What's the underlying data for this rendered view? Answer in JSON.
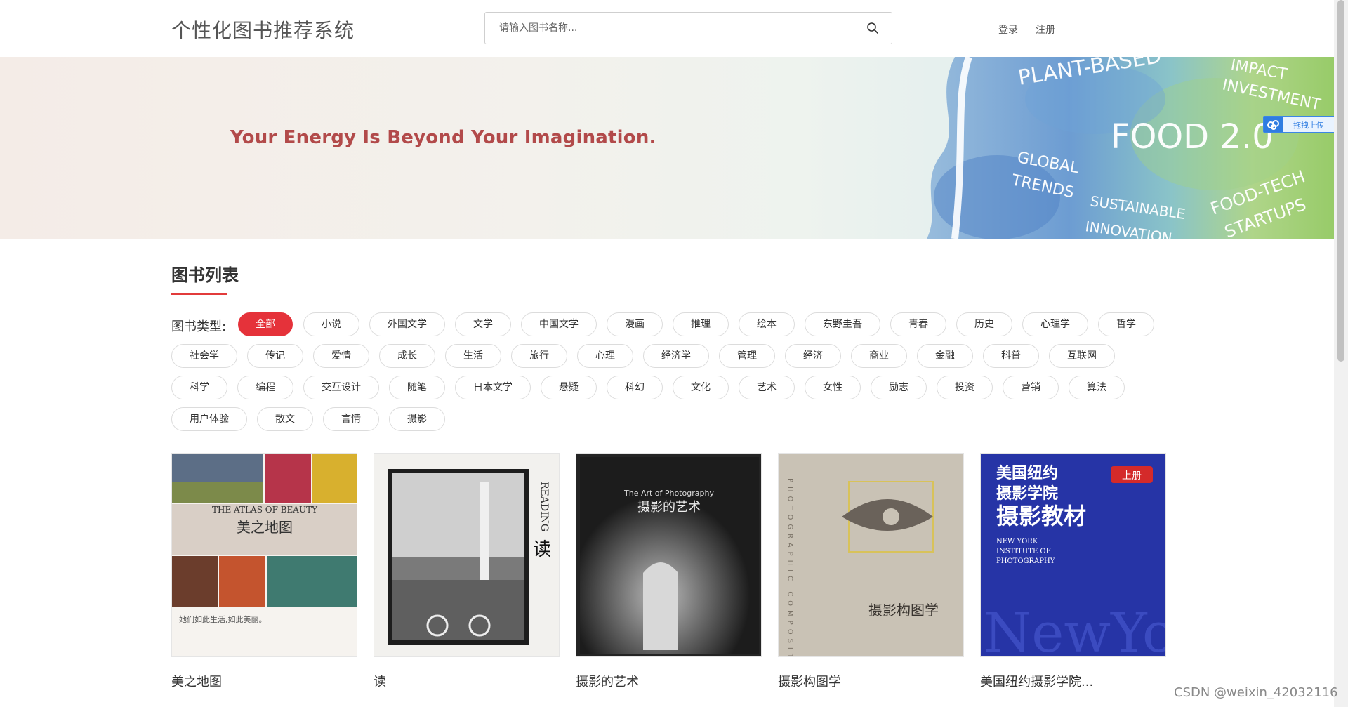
{
  "header": {
    "site_title": "个性化图书推荐系统",
    "search_placeholder": "请输入图书名称...",
    "login_label": "登录",
    "register_label": "注册"
  },
  "banner": {
    "slogan": "Your Energy Is Beyond Your Imagination.",
    "art_words": [
      "PLANT-BASED",
      "IMPACT",
      "INVESTMENT",
      "FOOD 2.0",
      "GLOBAL",
      "TRENDS",
      "SUSTAINABLE",
      "INNOVATION",
      "FOOD-TECH",
      "STARTUPS"
    ],
    "upload_badge": "拖拽上传"
  },
  "section": {
    "title": "图书列表",
    "type_label": "图书类型:"
  },
  "tags": [
    {
      "label": "全部",
      "active": true
    },
    {
      "label": "小说"
    },
    {
      "label": "外国文学"
    },
    {
      "label": "文学"
    },
    {
      "label": "中国文学"
    },
    {
      "label": "漫画"
    },
    {
      "label": "推理"
    },
    {
      "label": "绘本"
    },
    {
      "label": "东野圭吾"
    },
    {
      "label": "青春"
    },
    {
      "label": "历史"
    },
    {
      "label": "心理学"
    },
    {
      "label": "哲学"
    },
    {
      "label": "社会学"
    },
    {
      "label": "传记"
    },
    {
      "label": "爱情"
    },
    {
      "label": "成长"
    },
    {
      "label": "生活"
    },
    {
      "label": "旅行"
    },
    {
      "label": "心理"
    },
    {
      "label": "经济学"
    },
    {
      "label": "管理"
    },
    {
      "label": "经济"
    },
    {
      "label": "商业"
    },
    {
      "label": "金融"
    },
    {
      "label": "科普"
    },
    {
      "label": "互联网"
    },
    {
      "label": "科学"
    },
    {
      "label": "编程"
    },
    {
      "label": "交互设计"
    },
    {
      "label": "随笔"
    },
    {
      "label": "日本文学"
    },
    {
      "label": "悬疑"
    },
    {
      "label": "科幻"
    },
    {
      "label": "文化"
    },
    {
      "label": "艺术"
    },
    {
      "label": "女性"
    },
    {
      "label": "励志"
    },
    {
      "label": "投资"
    },
    {
      "label": "营销"
    },
    {
      "label": "算法"
    },
    {
      "label": "用户体验"
    },
    {
      "label": "散文"
    },
    {
      "label": "言情"
    },
    {
      "label": "摄影"
    }
  ],
  "books": [
    {
      "title": "美之地图",
      "cover_text": [
        "THE ATLAS OF BEAUTY",
        "美之地图",
        "她们如此生活,如此美丽。"
      ]
    },
    {
      "title": "读",
      "cover_text": [
        "READING",
        "读"
      ]
    },
    {
      "title": "摄影的艺术",
      "cover_text": [
        "The Art of Photography",
        "摄影的艺术"
      ]
    },
    {
      "title": "摄影构图学",
      "cover_text": [
        "PHOTOGRAPHIC COMPOSITION",
        "摄影构图学"
      ]
    },
    {
      "title": "美国纽约摄影学院...",
      "cover_text": [
        "美国纽约",
        "摄影学院",
        "摄影教材",
        "上册",
        "NEW YORK",
        "INSTITUTE OF",
        "PHOTOGRAPHY",
        "NewYork"
      ]
    }
  ],
  "watermark": "CSDN @weixin_42032116"
}
